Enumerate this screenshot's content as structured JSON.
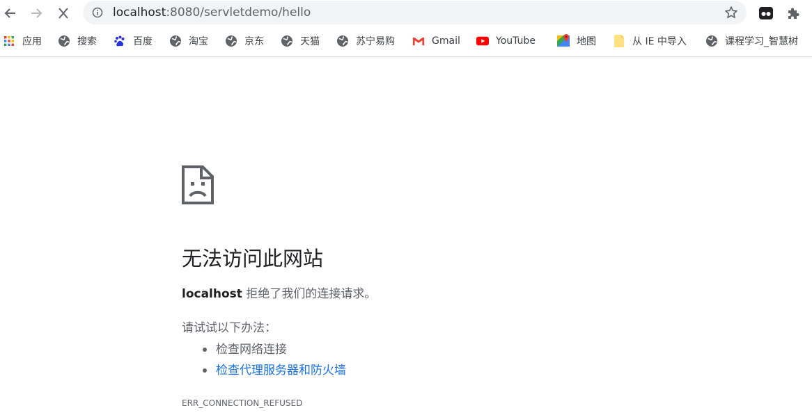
{
  "toolbar": {
    "back_icon": "arrow-left-icon",
    "forward_icon": "arrow-right-icon",
    "stop_icon": "close-icon",
    "url_host": "localhost",
    "url_path": ":8080/servletdemo/hello",
    "info_icon": "info-icon",
    "star_icon": "star-icon"
  },
  "bookmarks": [
    {
      "label": "应用",
      "icon": "apps-grid-icon"
    },
    {
      "label": "搜索",
      "icon": "globe-icon"
    },
    {
      "label": "百度",
      "icon": "baidu-paw-icon"
    },
    {
      "label": "淘宝",
      "icon": "globe-icon"
    },
    {
      "label": "京东",
      "icon": "globe-icon"
    },
    {
      "label": "天猫",
      "icon": "globe-icon"
    },
    {
      "label": "苏宁易购",
      "icon": "globe-icon"
    },
    {
      "label": "Gmail",
      "icon": "gmail-icon"
    },
    {
      "label": "YouTube",
      "icon": "youtube-icon"
    },
    {
      "label": "地图",
      "icon": "maps-pin-icon"
    },
    {
      "label": "从 IE 中导入",
      "icon": "folder-icon"
    },
    {
      "label": "课程学习_智慧树",
      "icon": "globe-icon"
    }
  ],
  "error": {
    "title": "无法访问此网站",
    "host": "localhost",
    "desc_suffix": " 拒绝了我们的连接请求。",
    "try_title": "请试试以下办法：",
    "suggestions": [
      "检查网络连接",
      "检查代理服务器和防火墙"
    ],
    "code": "ERR_CONNECTION_REFUSED"
  },
  "colors": {
    "link": "#1a73e8",
    "text_secondary": "#5f6368",
    "omnibox_bg": "#f1f3f4"
  }
}
